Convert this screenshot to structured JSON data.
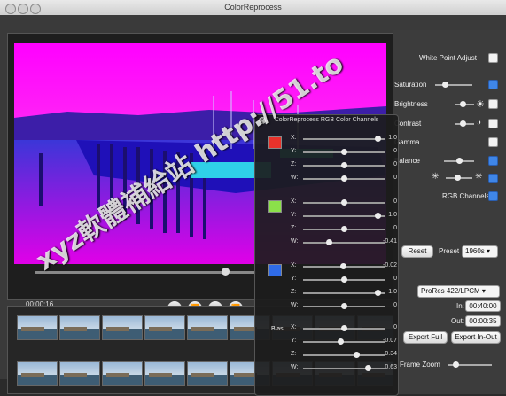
{
  "window": {
    "title": "ColorReprocess"
  },
  "player": {
    "timecode": "00:00:16",
    "progress": 0.86
  },
  "transport": {
    "rewind_end": "⏮",
    "rewind": "⏪",
    "play": "▶",
    "forward": "⏩"
  },
  "right_panel": {
    "white_point_label": "White Point Adjust",
    "saturation_label": "Saturation",
    "brightness_label": "Brightness",
    "contrast_label": "Contrast",
    "gamma_label": "Gamma",
    "balance_label": "Balance",
    "rgb_channels_label": "RGB Channels",
    "reset_label": "Reset",
    "preset_label": "Preset",
    "preset_value": "1960s",
    "codec_value": "ProRes 422/LPCM",
    "in_label": "In:",
    "in_value": "00:40:00",
    "out_label": "Out:",
    "out_value": "00:00:35",
    "export_full_label": "Export Full",
    "export_inout_label": "Export In-Out",
    "zoom_label": "Frame Zoom"
  },
  "rgb_panel": {
    "title": "ColorReprocess RGB Color Channels",
    "close": "×",
    "red": {
      "color": "#e8322b",
      "rows": [
        {
          "axis": "X:",
          "value": "1.0",
          "pos": 0.95
        },
        {
          "axis": "Y:",
          "value": "0",
          "pos": 0.5
        },
        {
          "axis": "Z:",
          "value": "0",
          "pos": 0.5
        },
        {
          "axis": "W:",
          "value": "0",
          "pos": 0.5
        }
      ]
    },
    "green": {
      "color": "#8be04a",
      "rows": [
        {
          "axis": "X:",
          "value": "0",
          "pos": 0.5
        },
        {
          "axis": "Y:",
          "value": "1.0",
          "pos": 0.95
        },
        {
          "axis": "Z:",
          "value": "0",
          "pos": 0.5
        },
        {
          "axis": "W:",
          "value": "-0.41",
          "pos": 0.3
        }
      ]
    },
    "blue": {
      "color": "#2f6be8",
      "rows": [
        {
          "axis": "X:",
          "value": "-0.02",
          "pos": 0.49
        },
        {
          "axis": "Y:",
          "value": "0",
          "pos": 0.5
        },
        {
          "axis": "Z:",
          "value": "1.0",
          "pos": 0.95
        },
        {
          "axis": "W:",
          "value": "0",
          "pos": 0.5
        }
      ]
    },
    "bias": {
      "label": "Bias",
      "rows": [
        {
          "axis": "X:",
          "value": "0",
          "pos": 0.5
        },
        {
          "axis": "Y:",
          "value": "-0.07",
          "pos": 0.46
        },
        {
          "axis": "Z:",
          "value": "0.34",
          "pos": 0.67
        },
        {
          "axis": "W:",
          "value": "0.63",
          "pos": 0.82
        }
      ]
    }
  },
  "watermark": {
    "text": "xyz軟體補給站 http://51.to"
  },
  "colors": {
    "magenta": "#ff00ff",
    "accent": "#3f86e8"
  }
}
